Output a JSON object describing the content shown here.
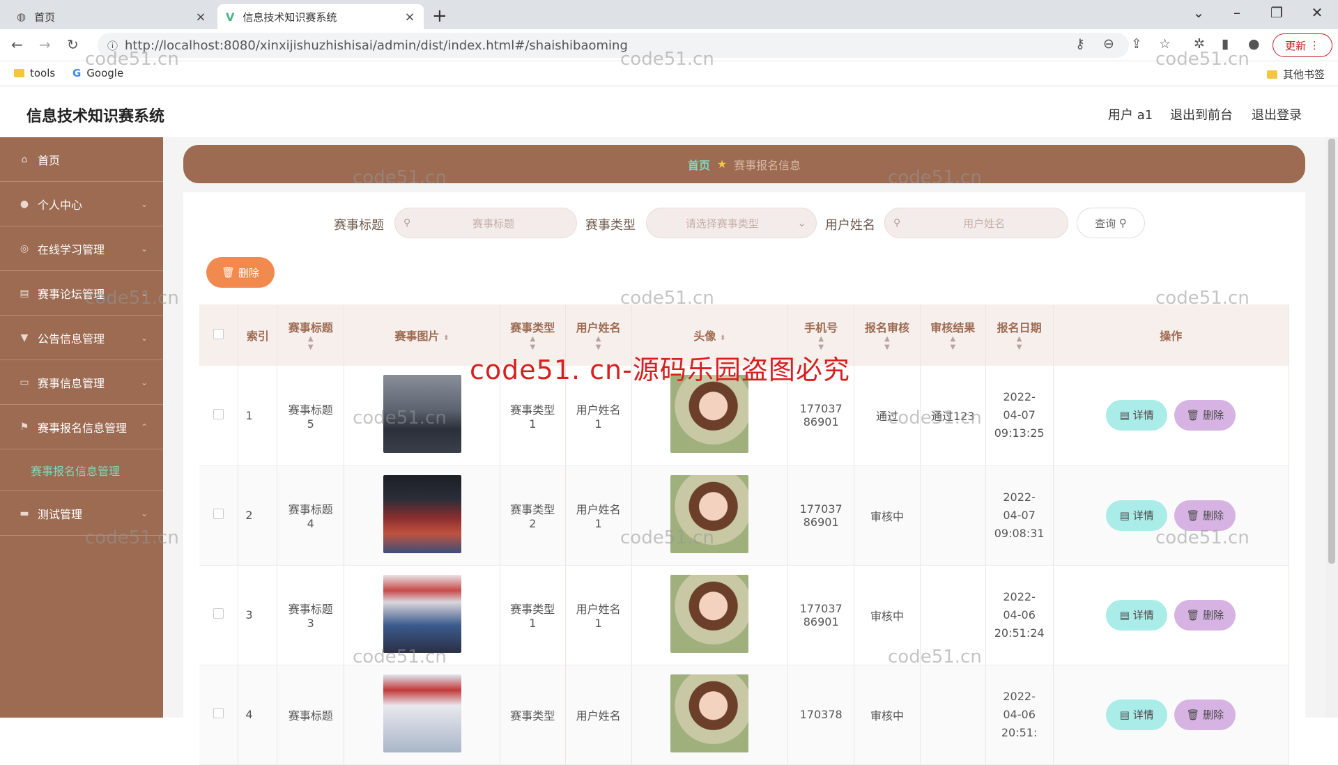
{
  "browser": {
    "tabs": [
      {
        "title": "首页"
      },
      {
        "title": "信息技术知识赛系统"
      }
    ],
    "url": "http://localhost:8080/xinxijishuzhishisai/admin/dist/index.html#/shaishibaoming",
    "update_label": "更新",
    "bookmarks": [
      "tools",
      "Google"
    ],
    "other_bookmarks": "其他书签"
  },
  "app": {
    "title": "信息技术知识赛系统",
    "user": "用户 a1",
    "back_front": "退出到前台",
    "logout": "退出登录"
  },
  "sidebar": {
    "items": [
      {
        "label": "首页",
        "icon": "home-icon"
      },
      {
        "label": "个人中心",
        "icon": "user-icon"
      },
      {
        "label": "在线学习管理",
        "icon": "study-icon"
      },
      {
        "label": "赛事论坛管理",
        "icon": "forum-icon"
      },
      {
        "label": "公告信息管理",
        "icon": "notice-icon"
      },
      {
        "label": "赛事信息管理",
        "icon": "event-icon"
      },
      {
        "label": "赛事报名信息管理",
        "icon": "flag-icon"
      },
      {
        "label": "测试管理",
        "icon": "test-icon"
      }
    ],
    "submenu": "赛事报名信息管理"
  },
  "breadcrumb": {
    "home": "首页",
    "current": "赛事报名信息"
  },
  "search": {
    "title_label": "赛事标题",
    "title_placeholder": "赛事标题",
    "type_label": "赛事类型",
    "type_placeholder": "请选择赛事类型",
    "name_label": "用户姓名",
    "name_placeholder": "用户姓名",
    "query_button": "查询"
  },
  "delete_button": "删除",
  "table": {
    "headers": [
      "索引",
      "赛事标题",
      "赛事图片",
      "赛事类型",
      "用户姓名",
      "头像",
      "手机号",
      "报名审核",
      "审核结果",
      "报名日期",
      "操作"
    ],
    "rows": [
      {
        "index": "1",
        "title": "赛事标题5",
        "type": "赛事类型1",
        "name": "用户姓名1",
        "phone": "17703786901",
        "audit": "通过",
        "result": "通过123",
        "date": "2022-04-07 09:13:25"
      },
      {
        "index": "2",
        "title": "赛事标题4",
        "type": "赛事类型2",
        "name": "用户姓名1",
        "phone": "17703786901",
        "audit": "审核中",
        "result": "",
        "date": "2022-04-07 09:08:31"
      },
      {
        "index": "3",
        "title": "赛事标题3",
        "type": "赛事类型1",
        "name": "用户姓名1",
        "phone": "17703786901",
        "audit": "审核中",
        "result": "",
        "date": "2022-04-06 20:51:24"
      },
      {
        "index": "4",
        "title": "赛事标题",
        "type": "赛事类型",
        "name": "用户姓名",
        "phone": "170378",
        "audit": "审核中",
        "result": "",
        "date": "2022-04-06 20:51:"
      }
    ],
    "detail_label": "详情",
    "delete_label": "删除"
  },
  "watermark": {
    "big": "code51. cn-源码乐园盗图必究",
    "small": "code51.cn"
  },
  "colors": {
    "brand": "#9c6b52",
    "detail_btn": "#a9ece8",
    "delete_btn": "#d6b3e2",
    "delete_main": "#f28a4f",
    "sub_active": "#7fd7b7"
  }
}
